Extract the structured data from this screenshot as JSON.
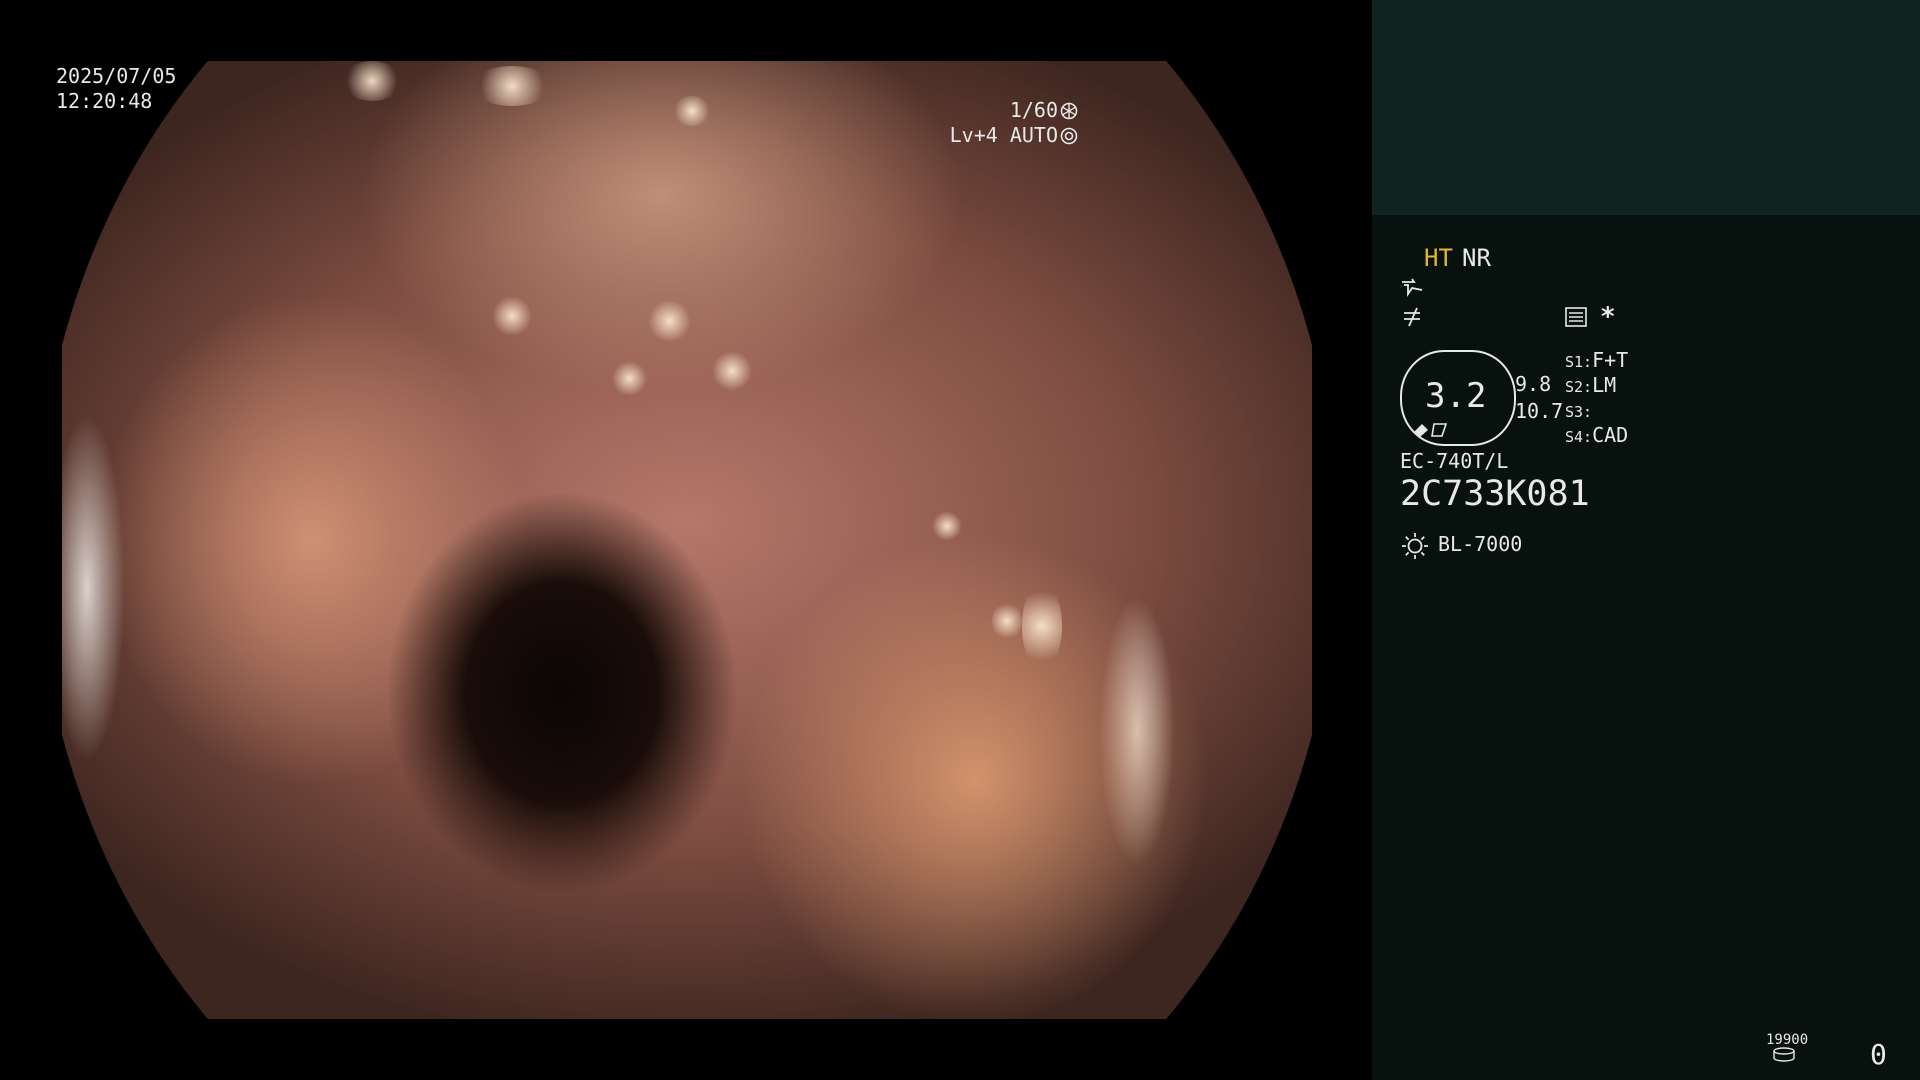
{
  "image_overlay": {
    "date": "2025/07/05",
    "time": "12:20:48",
    "shutter": "1/60",
    "shutter_icon": "shutter-icon",
    "iris_level": "Lv+4 AUTO",
    "iris_icon": "iris-icon"
  },
  "status_panel": {
    "mode_ht": "HT",
    "mode_nr": "NR",
    "contrast_icon": "contrast-icon",
    "enhance_icon": "enhance-icon",
    "menu_icon": "menu-icon",
    "asterisk": "*",
    "zoom_value": "3.2",
    "zoom_icon": "zoom-icon",
    "value_a": "9.8",
    "value_b": "10.7",
    "switches": [
      {
        "key": "S1:",
        "value": "F+T"
      },
      {
        "key": "S2:",
        "value": "LM"
      },
      {
        "key": "S3:",
        "value": ""
      },
      {
        "key": "S4:",
        "value": "CAD"
      }
    ],
    "scope_model": "EC-740T/L",
    "scope_serial": "2C733K081",
    "light_icon": "light-source-icon",
    "light_source": "BL-7000",
    "counter_small": "19900",
    "disk_icon": "disk-icon",
    "counter_big": "0"
  },
  "colors": {
    "panel_bg": "#07120f",
    "panel_top_bg": "#0f2321",
    "accent_ht": "#e5b52f",
    "text": "#e8e8e8"
  }
}
